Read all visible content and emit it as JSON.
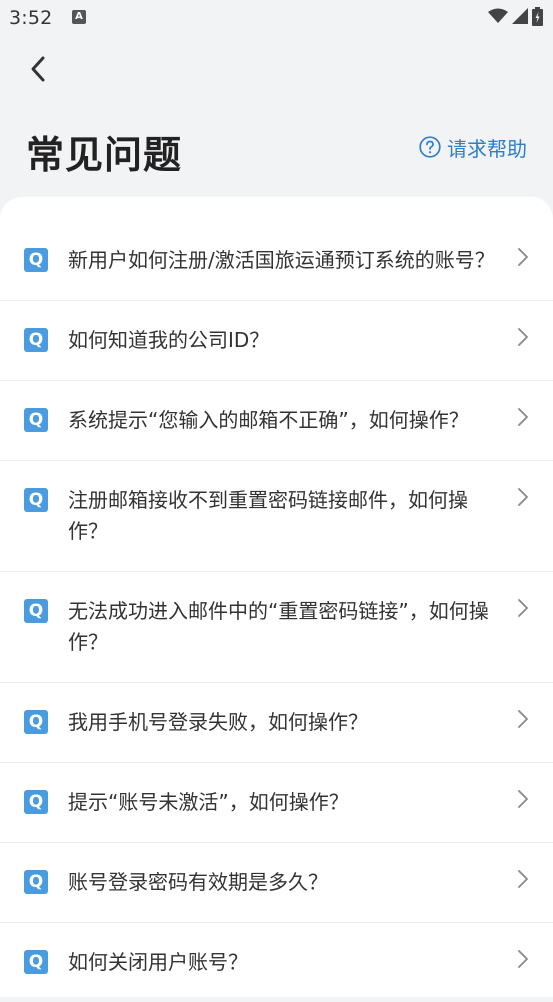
{
  "status_bar": {
    "time": "3:52",
    "notification_icon": "A"
  },
  "header": {
    "back_icon": "chevron-left-icon",
    "title": "常见问题",
    "help_label": "请求帮助",
    "accent_color": "#2f7ecb"
  },
  "faq": {
    "badge_label": "Q",
    "badge_color": "#4a9cdf",
    "items": [
      {
        "question": "新用户如何注册/激活国旅运通预订系统的账号？"
      },
      {
        "question": "如何知道我的公司ID？"
      },
      {
        "question": "系统提示“您输入的邮箱不正确”，如何操作？"
      },
      {
        "question": "注册邮箱接收不到重置密码链接邮件，如何操作？"
      },
      {
        "question": "无法成功进入邮件中的“重置密码链接”，如何操作？"
      },
      {
        "question": "我用手机号登录失败，如何操作？"
      },
      {
        "question": "提示“账号未激活”，如何操作？"
      },
      {
        "question": "账号登录密码有效期是多久？"
      },
      {
        "question": "如何关闭用户账号？"
      }
    ]
  }
}
